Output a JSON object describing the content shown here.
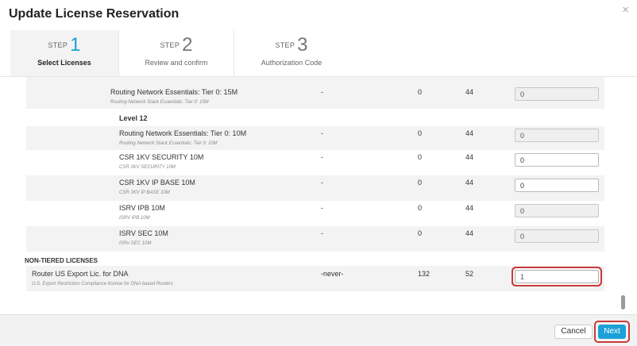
{
  "title": "Update License Reservation",
  "close_glyph": "×",
  "steps": [
    {
      "word": "STEP",
      "number": "1",
      "label": "Select Licenses",
      "active": true
    },
    {
      "word": "STEP",
      "number": "2",
      "label": "Review and confirm",
      "active": false
    },
    {
      "word": "STEP",
      "number": "3",
      "label": "Authorization Code",
      "active": false
    }
  ],
  "rows": {
    "r1": {
      "name": "Routing Network Essentials: Tier 0: 15M",
      "desc": "Routing Network Stack Essentials: Tier 0: 15M",
      "expiry": "-",
      "in_use": "0",
      "available": "44",
      "qty": "0"
    },
    "level12": "Level 12",
    "r2": {
      "name": "Routing Network Essentials: Tier 0: 10M",
      "desc": "Routing Network Stack Essentials: Tier 0: 10M",
      "expiry": "-",
      "in_use": "0",
      "available": "44",
      "qty": "0"
    },
    "r3": {
      "name": "CSR 1KV SECURITY 10M",
      "desc": "CSR 1KV SECURITY 10M",
      "expiry": "-",
      "in_use": "0",
      "available": "44",
      "qty": "0"
    },
    "r4": {
      "name": "CSR 1KV IP BASE 10M",
      "desc": "CSR 1KV IP BASE 10M",
      "expiry": "-",
      "in_use": "0",
      "available": "44",
      "qty": "0"
    },
    "r5": {
      "name": "ISRV IPB 10M",
      "desc": "ISRV IPB 10M",
      "expiry": "-",
      "in_use": "0",
      "available": "44",
      "qty": "0"
    },
    "r6": {
      "name": "ISRV SEC 10M",
      "desc": "ISRv SEC 10M",
      "expiry": "-",
      "in_use": "0",
      "available": "44",
      "qty": "0"
    },
    "section": "NON-TIERED LICENSES",
    "r7": {
      "name": "Router US Export Lic. for DNA",
      "desc": "U.S. Export Restriction Compliance license for DNA based Routers",
      "expiry": "-never-",
      "in_use": "132",
      "available": "52",
      "qty": "1"
    }
  },
  "footer": {
    "cancel": "Cancel",
    "next": "Next"
  },
  "colors": {
    "accent": "#1ba0d8",
    "highlight": "#c93a3a"
  }
}
